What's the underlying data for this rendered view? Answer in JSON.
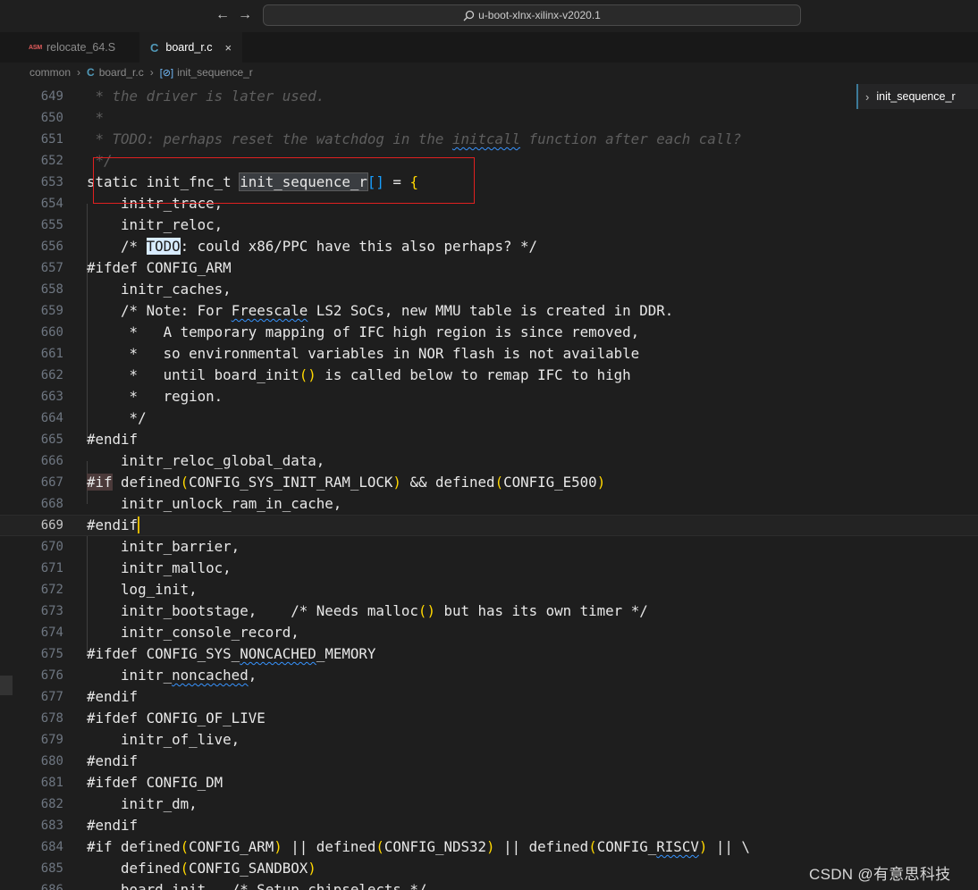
{
  "titlebar": {
    "back_icon": "←",
    "forward_icon": "→",
    "search_text": "u-boot-xlnx-xilinx-v2020.1"
  },
  "tabs": [
    {
      "label": "relocate_64.S",
      "icon": "ASM",
      "active": false
    },
    {
      "label": "board_r.c",
      "icon": "C",
      "active": true,
      "close": "×"
    }
  ],
  "breadcrumb": {
    "folder": "common",
    "file": "board_r.c",
    "symbol": "init_sequence_r"
  },
  "sticky_scroll": {
    "label": "init_sequence_r"
  },
  "watermark": "CSDN @有意思科技",
  "code_lines": [
    {
      "n": "649",
      "text": " * the driver is later used."
    },
    {
      "n": "650",
      "text": " *"
    },
    {
      "n": "651",
      "text": " * TODO: perhaps reset the watchdog in the initcall function after each call?"
    },
    {
      "n": "652",
      "text": " */"
    },
    {
      "n": "653",
      "text": "static init_fnc_t init_sequence_r[] = {"
    },
    {
      "n": "654",
      "text": "    initr_trace,"
    },
    {
      "n": "655",
      "text": "    initr_reloc,"
    },
    {
      "n": "656",
      "text": "    /* TODO: could x86/PPC have this also perhaps? */"
    },
    {
      "n": "657",
      "text": "#ifdef CONFIG_ARM"
    },
    {
      "n": "658",
      "text": "    initr_caches,"
    },
    {
      "n": "659",
      "text": "    /* Note: For Freescale LS2 SoCs, new MMU table is created in DDR."
    },
    {
      "n": "660",
      "text": "     *   A temporary mapping of IFC high region is since removed,"
    },
    {
      "n": "661",
      "text": "     *   so environmental variables in NOR flash is not available"
    },
    {
      "n": "662",
      "text": "     *   until board_init() is called below to remap IFC to high"
    },
    {
      "n": "663",
      "text": "     *   region."
    },
    {
      "n": "664",
      "text": "     */"
    },
    {
      "n": "665",
      "text": "#endif"
    },
    {
      "n": "666",
      "text": "    initr_reloc_global_data,"
    },
    {
      "n": "667",
      "text": "#if defined(CONFIG_SYS_INIT_RAM_LOCK) && defined(CONFIG_E500)"
    },
    {
      "n": "668",
      "text": "    initr_unlock_ram_in_cache,"
    },
    {
      "n": "669",
      "text": "#endif"
    },
    {
      "n": "670",
      "text": "    initr_barrier,"
    },
    {
      "n": "671",
      "text": "    initr_malloc,"
    },
    {
      "n": "672",
      "text": "    log_init,"
    },
    {
      "n": "673",
      "text": "    initr_bootstage,    /* Needs malloc() but has its own timer */"
    },
    {
      "n": "674",
      "text": "    initr_console_record,"
    },
    {
      "n": "675",
      "text": "#ifdef CONFIG_SYS_NONCACHED_MEMORY"
    },
    {
      "n": "676",
      "text": "    initr_noncached,"
    },
    {
      "n": "677",
      "text": "#endif"
    },
    {
      "n": "678",
      "text": "#ifdef CONFIG_OF_LIVE"
    },
    {
      "n": "679",
      "text": "    initr_of_live,"
    },
    {
      "n": "680",
      "text": "#endif"
    },
    {
      "n": "681",
      "text": "#ifdef CONFIG_DM"
    },
    {
      "n": "682",
      "text": "    initr_dm,"
    },
    {
      "n": "683",
      "text": "#endif"
    },
    {
      "n": "684",
      "text": "#if defined(CONFIG_ARM) || defined(CONFIG_NDS32) || defined(CONFIG_RISCV) || \\"
    },
    {
      "n": "685",
      "text": "    defined(CONFIG_SANDBOX)"
    },
    {
      "n": "686",
      "text": "    board_init,  /* Setup chipselects */"
    }
  ]
}
